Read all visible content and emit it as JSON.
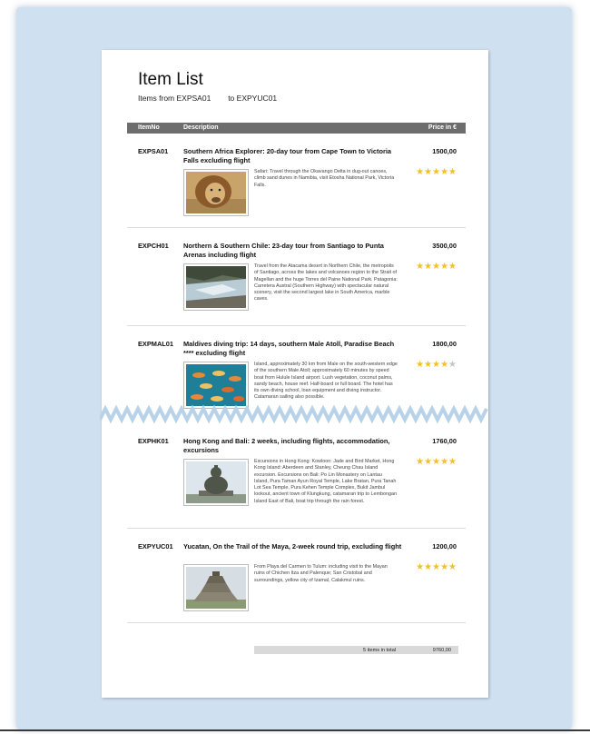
{
  "report": {
    "title": "Item List",
    "subtitle": "Items from EXPSA01        to EXPYUC01",
    "columns": {
      "item_no": "ItemNo",
      "description": "Description",
      "price": "Price in €"
    }
  },
  "items": [
    {
      "no": "EXPSA01",
      "title": "Southern Africa Explorer: 20-day tour from Cape Town to Victoria Falls excluding flight",
      "price": "1500,00",
      "text": "Safari: Travel through the Okavango Delta in dug-out canoes, climb sand dunes in Namibia, visit Etosha National Park, Victoria Falls.",
      "rating": 5,
      "image_icon": "lion-photo"
    },
    {
      "no": "EXPCH01",
      "title": "Northern & Southern Chile: 23-day tour from Santiago to Punta Arenas including flight",
      "price": "3500,00",
      "text": "Travel from the Atacama desert in Northern Chile, the metropolis of Santiago, across the lakes and volcanoes region to the Strait of Magellan and the huge Torres del Paine National Park. Patagonia: Carretera Austral (Southern Highway) with spectacular natural scenery, visit the second largest lake in South America, marble caves.",
      "rating": 5,
      "image_icon": "river-photo"
    },
    {
      "no": "EXPMAL01",
      "title": "Maldives diving trip: 14 days, southern Male Atoll, Paradise Beach **** excluding flight",
      "price": "1800,00",
      "text": "Island, approximately 30 km from Male on the south-western edge of the southern Male Atoll; approximately 60 minutes by speed boat from Hulule Island airport. Lush vegetation, coconut palms, sandy beach, house reef. Half-board or full board. The hotel has its own diving school, loan equipment and diving instructor. Catamaran sailing also possible.",
      "rating": 4,
      "image_icon": "fish-photo"
    },
    {
      "no": "EXPHK01",
      "title": "Hong Kong and Bali: 2 weeks, including flights, accommodation, excursions",
      "price": "1760,00",
      "text": "Excursions in Hong Kong: Kowloon: Jade and Bird Market, Hong Kong Island: Aberdeen and Stanley, Cheung Chau Island excursion. Excursions on Bali: Po Lin Monastery on Lantau Island, Pura Taman Ayun Royal Temple, Lake Bratan, Pura Tanah Lot Sea Temple, Pura Kehen Temple Complex, Bukit Jambul lookout, ancient town of Klungkung, catamaran trip to Lembongan Island East of Bali, boat trip through the rain forest.",
      "rating": 5,
      "image_icon": "buddha-photo"
    },
    {
      "no": "EXPYUC01",
      "title": "Yucatan, On the Trail of the Maya, 2-week round trip, excluding flight",
      "price": "1200,00",
      "text": "From Playa del Carmen to Tulum: including visit to the Mayan ruins of Chichen Itza and Palenque; San Cristobal and surroundings, yellow city of Izamal, Calakmul ruins.",
      "rating": 5,
      "image_icon": "pyramid-photo"
    }
  ],
  "totals": {
    "label": "5 items in total",
    "sum": "9760,00"
  },
  "colors": {
    "backdrop": "#cfe0f0",
    "header_bar": "#6d6d6d",
    "star": "#f2c029",
    "star_off": "#c4c4c4",
    "zigzag": "#b8d2ea"
  }
}
